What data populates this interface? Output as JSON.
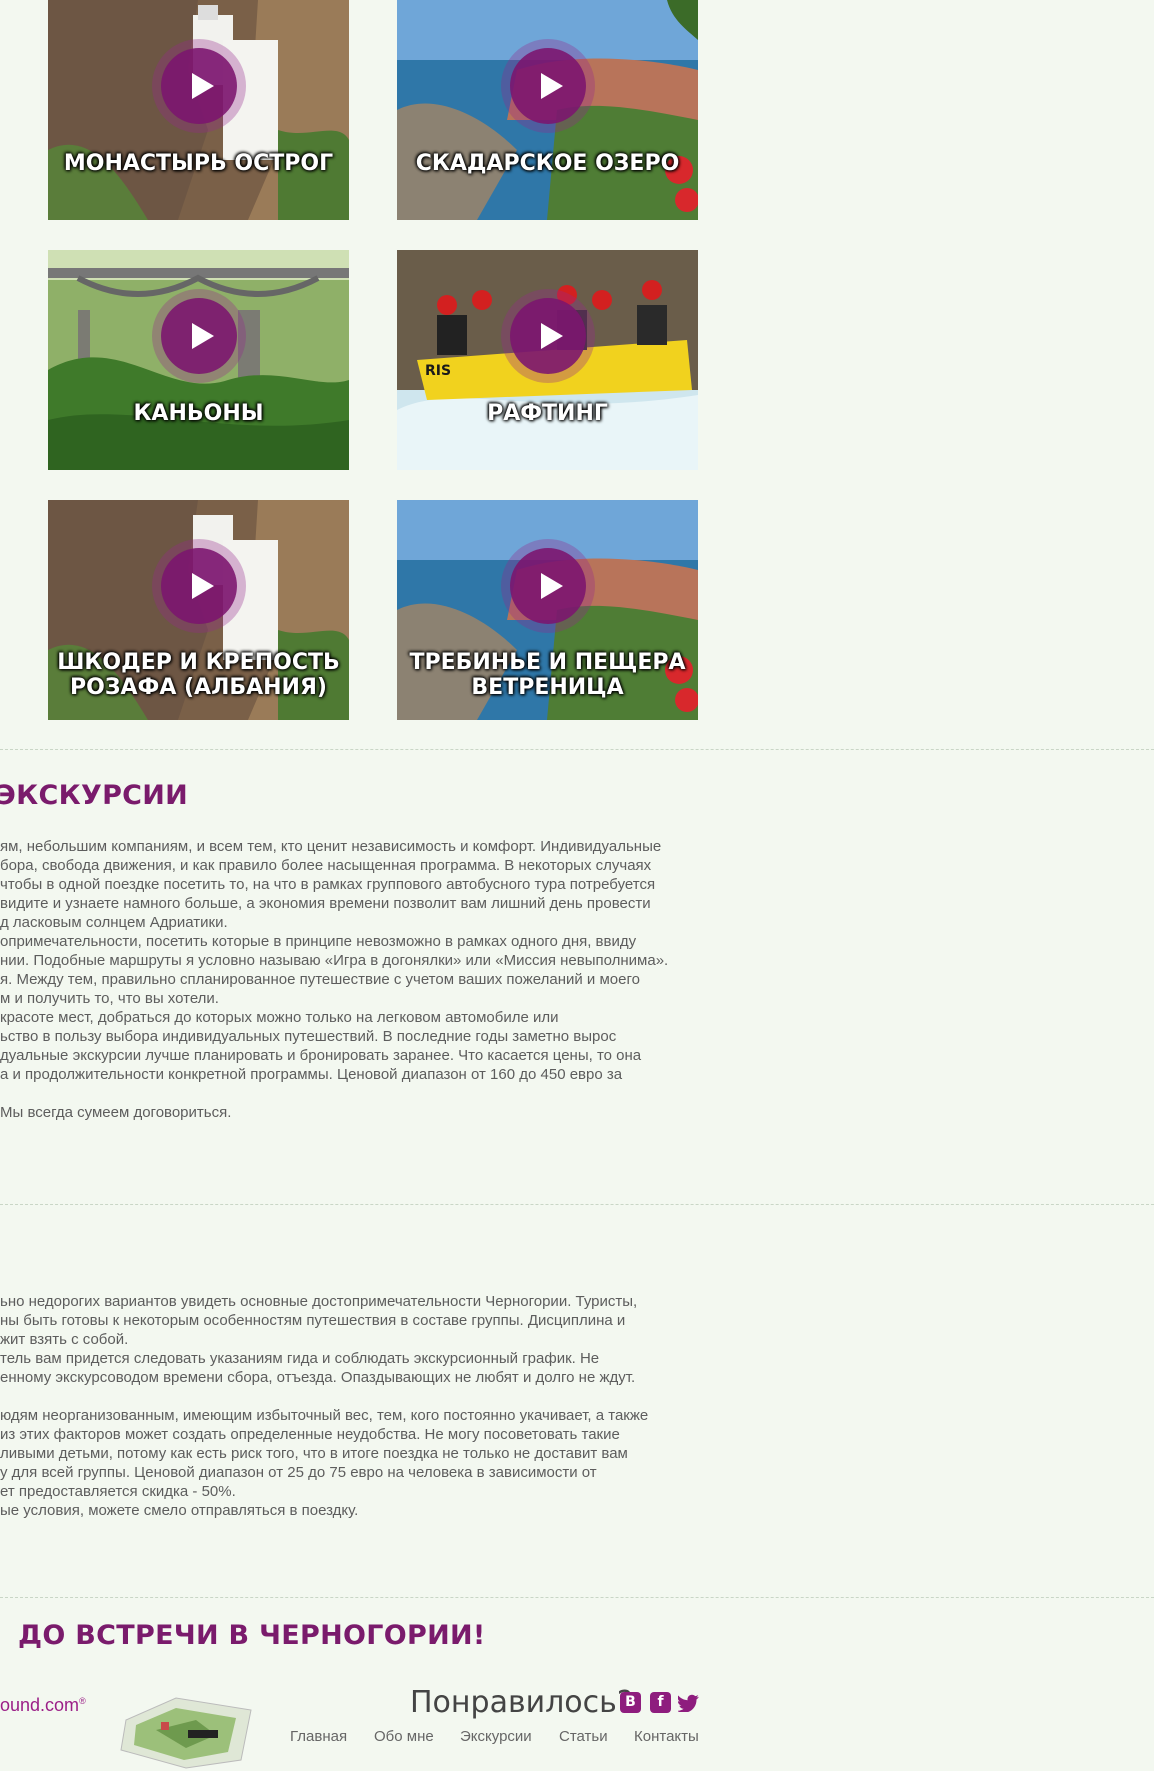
{
  "tiles": [
    {
      "title": "МОНАСТЫРЬ ОСТРОГ"
    },
    {
      "title": "СКАДАРСКОЕ ОЗЕРО"
    },
    {
      "title": "КАНЬОНЫ"
    },
    {
      "title": "РАФТИНГ",
      "raft_text": "RIS"
    },
    {
      "title": "ШКОДЕР И КРЕПОСТЬ\nРОЗАФА (АЛБАНИЯ)"
    },
    {
      "title": "ТРЕБИНЬЕ И ПЕЩЕРА\nВЕТРЕНИЦА"
    }
  ],
  "individual": {
    "heading": "ЭКСКУРСИИ",
    "lines": [
      "ям, небольшим компаниям, и всем тем, кто ценит независимость  и комфорт. Индивидуальные",
      "бора, свобода движения,  и как правило более насыщенная программа.  В некоторых случаях",
      "чтобы в одной поездке посетить то, на что в рамках группового автобусного тура потребуется",
      "видите и узнаете намного больше, а экономия времени позволит вам  лишний день провести",
      "д ласковым солнцем Адриатики.",
      "опримечательности, посетить которые в принципе невозможно в рамках одного дня, ввиду",
      "нии. Подобные маршруты я условно называю «Игра в  догонялки» или «Миссия невыполнима».",
      "я. Между тем, правильно спланированное путешествие с учетом ваших пожеланий и моего",
      "м и получить то, что вы хотели.",
      "красоте мест, добраться до которых можно только на легковом автомобиле или",
      "ьство в пользу выбора индивидуальных путешествий. В последние годы заметно вырос",
      "дуальные экскурсии лучше планировать и бронировать заранее.  Что касается цены, то она",
      "а и продолжительности конкретной программы. Ценовой диапазон от 160 до 450 евро за",
      "",
      "Мы всегда сумеем договориться."
    ]
  },
  "group": {
    "lines": [
      "ьно недорогих вариантов увидеть основные достопримечательности Черногории. Туристы,",
      "ны быть готовы к некоторым особенностям путешествия  в составе группы.  Дисциплина и",
      "жит взять с собой.",
      "тель вам придется следовать указаниям гида и соблюдать экскурсионный график. Не",
      "енному экскурсоводом времени сбора, отъезда. Опаздывающих не любят и долго не ждут.",
      "",
      "юдям неорганизованным, имеющим избыточный вес, тем, кого постоянно укачивает, а также",
      "из этих факторов может создать определенные неудобства. Не могу посоветовать такие",
      "ливыми детьми, потому как есть риск того, что в итоге поездка не только не доставит вам",
      "у для всей группы. Ценовой диапазон от 25 до 75 евро на человека в зависимости от",
      "ет предоставляется скидка - 50%.",
      "ые условия, можете смело отправляться в поездку."
    ]
  },
  "farewell": {
    "heading": "ДО ВСТРЕЧИ В ЧЕРНОГОРИИ!"
  },
  "footer": {
    "logo_text": "ound.com",
    "logo_mark": "®",
    "liked": "Понравилось?",
    "social": [
      {
        "label": "В",
        "icon": "vk-icon"
      },
      {
        "label": "f",
        "icon": "facebook-icon"
      },
      {
        "label": "",
        "icon": "twitter-icon"
      }
    ],
    "nav": [
      "Главная",
      "Обо мне",
      "Экскурсии",
      "Статьи",
      "Контакты"
    ],
    "accent": "#8e1d7e"
  }
}
